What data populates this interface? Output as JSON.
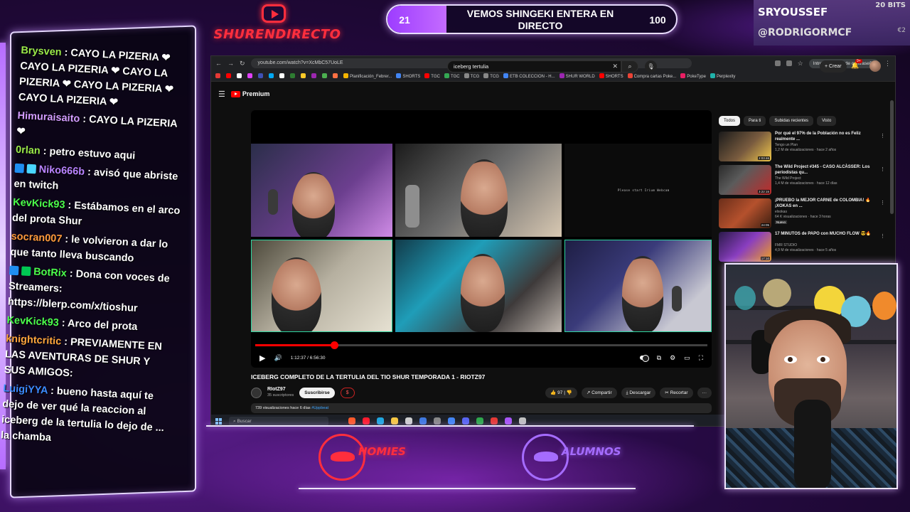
{
  "overlay": {
    "channel_logo_text": "SHURENDIRECTO",
    "goal": {
      "start": "21",
      "end": "100",
      "title": "VEMOS SHINGEKI ENTERA EN DIRECTO",
      "progress": 0.21
    },
    "top_right": {
      "name": "SRYOUSSEF",
      "bits": "20 BITS",
      "handle": "@RODRIGORMCF",
      "amount": "€2"
    },
    "bottom_logos": {
      "left": "HOMIES",
      "right": "ALUMNOS"
    },
    "colors": {
      "brand_red": "#ff2e3d",
      "purple": "#a56cff",
      "frame": "#f0e6ff"
    }
  },
  "chat": [
    {
      "user": "Brysven",
      "color": "#9bea4a",
      "text": ": CAYO LA PIZERIA ❤ CAYO LA PIZERIA ❤ CAYO LA PIZERIA ❤ CAYO LA PIZERIA ❤ CAYO LA PIZERIA ❤"
    },
    {
      "user": "Himuraisaito",
      "color": "#d39cff",
      "text": ": CAYO LA PIZERIA ❤"
    },
    {
      "user": "0rlan",
      "color": "#9bea4a",
      "text": ": petro estuvo aqui"
    },
    {
      "user": "Niko666b",
      "color": "#b983ff",
      "text": ": avisó que abriste en twitch",
      "badges": [
        "prime-badge",
        "diamond-badge"
      ]
    },
    {
      "user": "KevKick93",
      "color": "#4cff4c",
      "text": ": Estábamos en el arco del prota Shur"
    },
    {
      "user": "socran007",
      "color": "#ff9a3c",
      "text": ": le volvieron a dar lo que tanto lleva buscando"
    },
    {
      "user": "BotRix",
      "color": "#4cff4c",
      "text": ": Dona con voces de Streamers: https://blerp.com/x/tioshur",
      "badges": [
        "prime-badge",
        "verified-badge"
      ]
    },
    {
      "user": "KevKick93",
      "color": "#4cff4c",
      "text": ": Arco del prota"
    },
    {
      "user": "knightcritic",
      "color": "#ffa63c",
      "text": ": PREVIAMENTE EN LAS AVENTURAS DE SHUR Y SUS AMIGOS:"
    },
    {
      "user": "LuigiYYA",
      "color": "#3c8bff",
      "text": ": bueno hasta aquí te dejo de ver qué la reaccion al iceberg de la tertulia lo dejo de ... la chamba"
    }
  ],
  "browser": {
    "url": "youtube.com/watch?v=XcMbC57UoLE",
    "profile_pill": "Introducir frase de contraseña",
    "bookmarks": [
      "Planificación_Febrer...",
      "SHORTS",
      "TGC",
      "TGC",
      "TCG",
      "TCG",
      "ETB COLECCION - H...",
      "SHUR WORLD",
      "SHORTS",
      "Compra cartas Poke...",
      "PokeType",
      "Perplexity"
    ],
    "youtube": {
      "logo": "Premium",
      "search_value": "iceberg tertulia",
      "create_label": "+ Crear",
      "notif_count": "9+",
      "video": {
        "title": "ICEBERG COMPLETO DE LA TERTULIA DEL TIO SHUR TEMPORADA 1 - RIOTZ97",
        "time": "1:12:37 / 6:56:30",
        "progress": 0.174,
        "cam_caption": "Please start Irium Webcam",
        "hover_time": "1:12:37"
      },
      "channel": {
        "name": "RIotZ97",
        "subs": "35 suscriptores",
        "subscribe": "Suscribirse",
        "extra": "$"
      },
      "actions": {
        "likes": "97",
        "share": "Compartir",
        "download": "Descargar",
        "clip": "Recortar",
        "more": "···"
      },
      "description": {
        "views": "739 visualizaciones",
        "ago": "hace 6 días",
        "tag": "#Uppbeat"
      },
      "chips": [
        "Todos",
        "Para ti",
        "Subidas recientes",
        "Visto"
      ],
      "recommendations": [
        {
          "title": "Por qué el 97% de la Población no es Feliz realmente ...",
          "channel": "Tengo un Plan",
          "meta": "1,2 M de visualizaciones · hace 2 años",
          "duration": "2:03:46"
        },
        {
          "title": "The Wild Project #345 - CASO ALCÀSSER: Los periodistas qu...",
          "channel": "The Wild Project",
          "meta": "1,4 M de visualizaciones · hace 12 días",
          "duration": "3:22:15"
        },
        {
          "title": "¡PRUEBO la MEJOR CARNE de COLOMBIA! 🔥 ¡XOKAS en ...",
          "channel": "elxokas",
          "meta": "64 K visualizaciones · hace 3 horas",
          "duration": "24:05",
          "badge": "Nuevo"
        },
        {
          "title": "17 MINUTOS de PAPO con MUCHO FLOW 😎🔥",
          "channel": "FMR STUDIO",
          "meta": "4,9 M de visualizaciones · hace 5 años",
          "duration": "17:10"
        }
      ]
    },
    "taskbar": {
      "search": "Buscar"
    }
  }
}
